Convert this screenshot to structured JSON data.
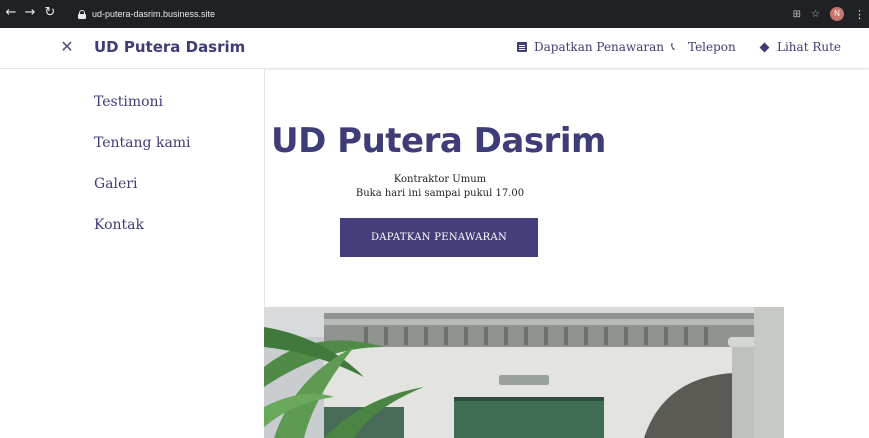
{
  "browser": {
    "url": "ud-putera-dasrim.business.site",
    "avatar_letter": "N",
    "icons": [
      "back-icon",
      "forward-icon",
      "reload-icon",
      "lock-icon",
      "translate-icon",
      "star-icon",
      "kebab-menu-icon"
    ]
  },
  "header": {
    "brand": "UD Putera Dasrim",
    "nav": [
      {
        "label": "Dapatkan Penawaran",
        "icon": "document-icon"
      },
      {
        "label": "Telepon",
        "icon": "phone-icon"
      },
      {
        "label": "Lihat Rute",
        "icon": "directions-icon"
      }
    ]
  },
  "sidebar": {
    "items": [
      {
        "label": "Testimoni"
      },
      {
        "label": "Tentang kami"
      },
      {
        "label": "Galeri"
      },
      {
        "label": "Kontak"
      }
    ]
  },
  "hero": {
    "title": "UD Putera Dasrim",
    "category": "Kontraktor Umum",
    "hours": "Buka hari ini sampai pukul 17.00",
    "cta_label": "DAPATKAN PENAWARAN"
  },
  "colors": {
    "brand": "#3f3d78",
    "cta": "#443f7a",
    "chrome": "#202124"
  }
}
